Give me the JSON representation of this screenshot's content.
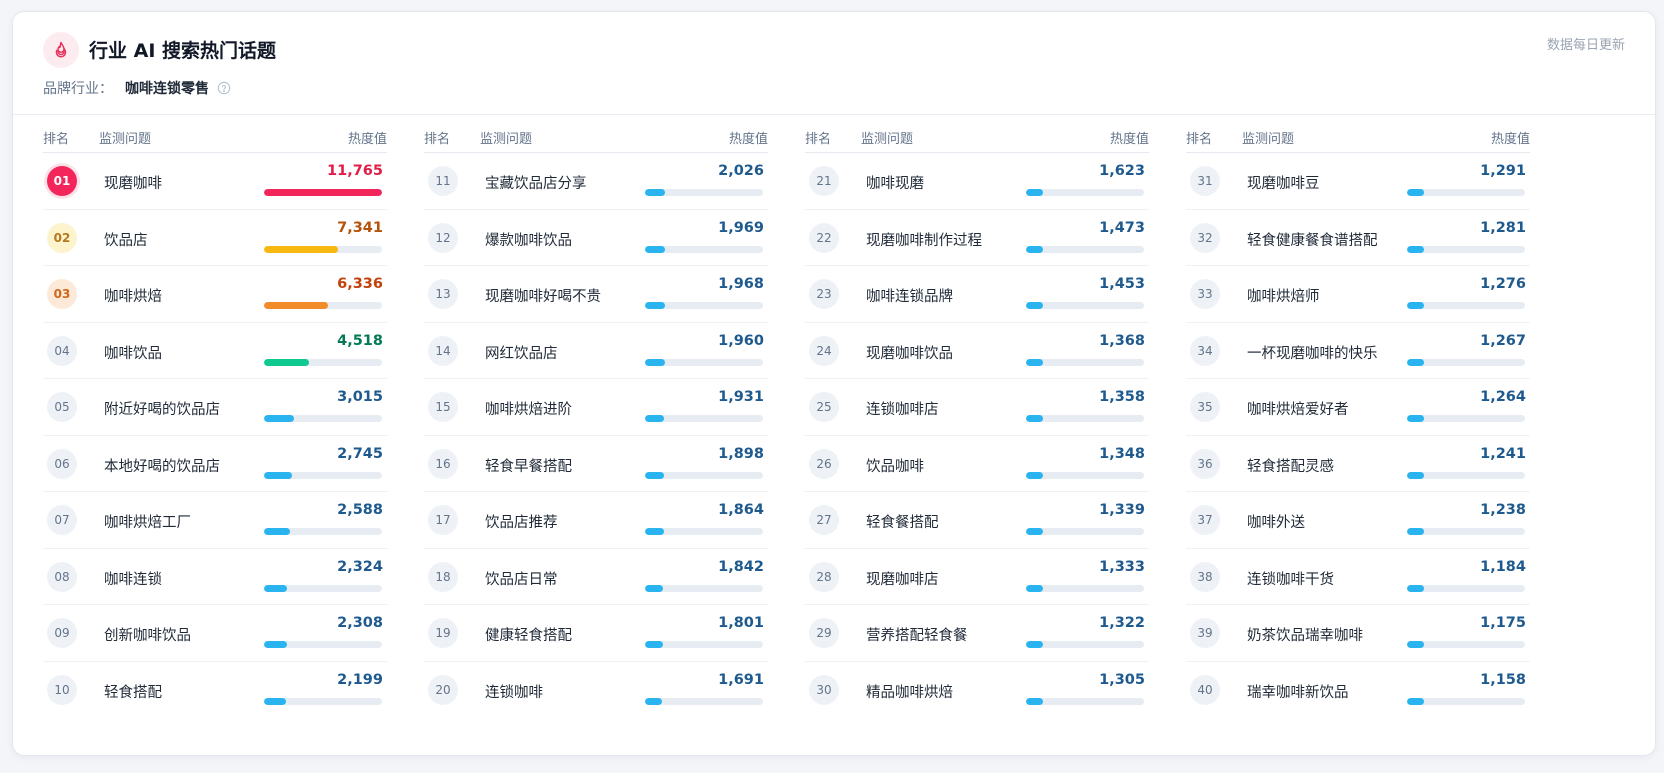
{
  "header": {
    "title": "行业 AI 搜索热门话题",
    "industry_label": "品牌行业：",
    "industry_value": "咖啡连锁零售",
    "update_note": "数据每日更新",
    "icon": "flame-icon",
    "help_icon": "question-circle-icon"
  },
  "columns_header": {
    "rank": "排名",
    "question": "监测问题",
    "heat": "热度值"
  },
  "colors": {
    "accent": "#f2265a",
    "bar_default": "#2ab4ef",
    "bar_rank1": "#f2265a",
    "bar_rank2": "#f7b811",
    "bar_rank3": "#f28c28",
    "bar_rank4": "#10c98f",
    "value_default": "#1f5a8f",
    "value_rank1": "#e11d48",
    "value_rank2": "#b45309",
    "value_rank3": "#c2410c",
    "value_rank4": "#047857"
  },
  "rows": [
    {
      "rank": "01",
      "question": "现磨咖啡",
      "value": "11,765",
      "heat": 11765
    },
    {
      "rank": "02",
      "question": "饮品店",
      "value": "7,341",
      "heat": 7341
    },
    {
      "rank": "03",
      "question": "咖啡烘焙",
      "value": "6,336",
      "heat": 6336
    },
    {
      "rank": "04",
      "question": "咖啡饮品",
      "value": "4,518",
      "heat": 4518
    },
    {
      "rank": "05",
      "question": "附近好喝的饮品店",
      "value": "3,015",
      "heat": 3015
    },
    {
      "rank": "06",
      "question": "本地好喝的饮品店",
      "value": "2,745",
      "heat": 2745
    },
    {
      "rank": "07",
      "question": "咖啡烘焙工厂",
      "value": "2,588",
      "heat": 2588
    },
    {
      "rank": "08",
      "question": "咖啡连锁",
      "value": "2,324",
      "heat": 2324
    },
    {
      "rank": "09",
      "question": "创新咖啡饮品",
      "value": "2,308",
      "heat": 2308
    },
    {
      "rank": "10",
      "question": "轻食搭配",
      "value": "2,199",
      "heat": 2199
    },
    {
      "rank": "11",
      "question": "宝藏饮品店分享",
      "value": "2,026",
      "heat": 2026
    },
    {
      "rank": "12",
      "question": "爆款咖啡饮品",
      "value": "1,969",
      "heat": 1969
    },
    {
      "rank": "13",
      "question": "现磨咖啡好喝不贵",
      "value": "1,968",
      "heat": 1968
    },
    {
      "rank": "14",
      "question": "网红饮品店",
      "value": "1,960",
      "heat": 1960
    },
    {
      "rank": "15",
      "question": "咖啡烘焙进阶",
      "value": "1,931",
      "heat": 1931
    },
    {
      "rank": "16",
      "question": "轻食早餐搭配",
      "value": "1,898",
      "heat": 1898
    },
    {
      "rank": "17",
      "question": "饮品店推荐",
      "value": "1,864",
      "heat": 1864
    },
    {
      "rank": "18",
      "question": "饮品店日常",
      "value": "1,842",
      "heat": 1842
    },
    {
      "rank": "19",
      "question": "健康轻食搭配",
      "value": "1,801",
      "heat": 1801
    },
    {
      "rank": "20",
      "question": "连锁咖啡",
      "value": "1,691",
      "heat": 1691
    },
    {
      "rank": "21",
      "question": "咖啡现磨",
      "value": "1,623",
      "heat": 1623
    },
    {
      "rank": "22",
      "question": "现磨咖啡制作过程",
      "value": "1,473",
      "heat": 1473
    },
    {
      "rank": "23",
      "question": "咖啡连锁品牌",
      "value": "1,453",
      "heat": 1453
    },
    {
      "rank": "24",
      "question": "现磨咖啡饮品",
      "value": "1,368",
      "heat": 1368
    },
    {
      "rank": "25",
      "question": "连锁咖啡店",
      "value": "1,358",
      "heat": 1358
    },
    {
      "rank": "26",
      "question": "饮品咖啡",
      "value": "1,348",
      "heat": 1348
    },
    {
      "rank": "27",
      "question": "轻食餐搭配",
      "value": "1,339",
      "heat": 1339
    },
    {
      "rank": "28",
      "question": "现磨咖啡店",
      "value": "1,333",
      "heat": 1333
    },
    {
      "rank": "29",
      "question": "营养搭配轻食餐",
      "value": "1,322",
      "heat": 1322
    },
    {
      "rank": "30",
      "question": "精品咖啡烘焙",
      "value": "1,305",
      "heat": 1305
    },
    {
      "rank": "31",
      "question": "现磨咖啡豆",
      "value": "1,291",
      "heat": 1291
    },
    {
      "rank": "32",
      "question": "轻食健康餐食谱搭配",
      "value": "1,281",
      "heat": 1281
    },
    {
      "rank": "33",
      "question": "咖啡烘焙师",
      "value": "1,276",
      "heat": 1276
    },
    {
      "rank": "34",
      "question": "一杯现磨咖啡的快乐",
      "value": "1,267",
      "heat": 1267
    },
    {
      "rank": "35",
      "question": "咖啡烘焙爱好者",
      "value": "1,264",
      "heat": 1264
    },
    {
      "rank": "36",
      "question": "轻食搭配灵感",
      "value": "1,241",
      "heat": 1241
    },
    {
      "rank": "37",
      "question": "咖啡外送",
      "value": "1,238",
      "heat": 1238
    },
    {
      "rank": "38",
      "question": "连锁咖啡干货",
      "value": "1,184",
      "heat": 1184
    },
    {
      "rank": "39",
      "question": "奶茶饮品瑞幸咖啡",
      "value": "1,175",
      "heat": 1175
    },
    {
      "rank": "40",
      "question": "瑞幸咖啡新饮品",
      "value": "1,158",
      "heat": 1158
    }
  ]
}
